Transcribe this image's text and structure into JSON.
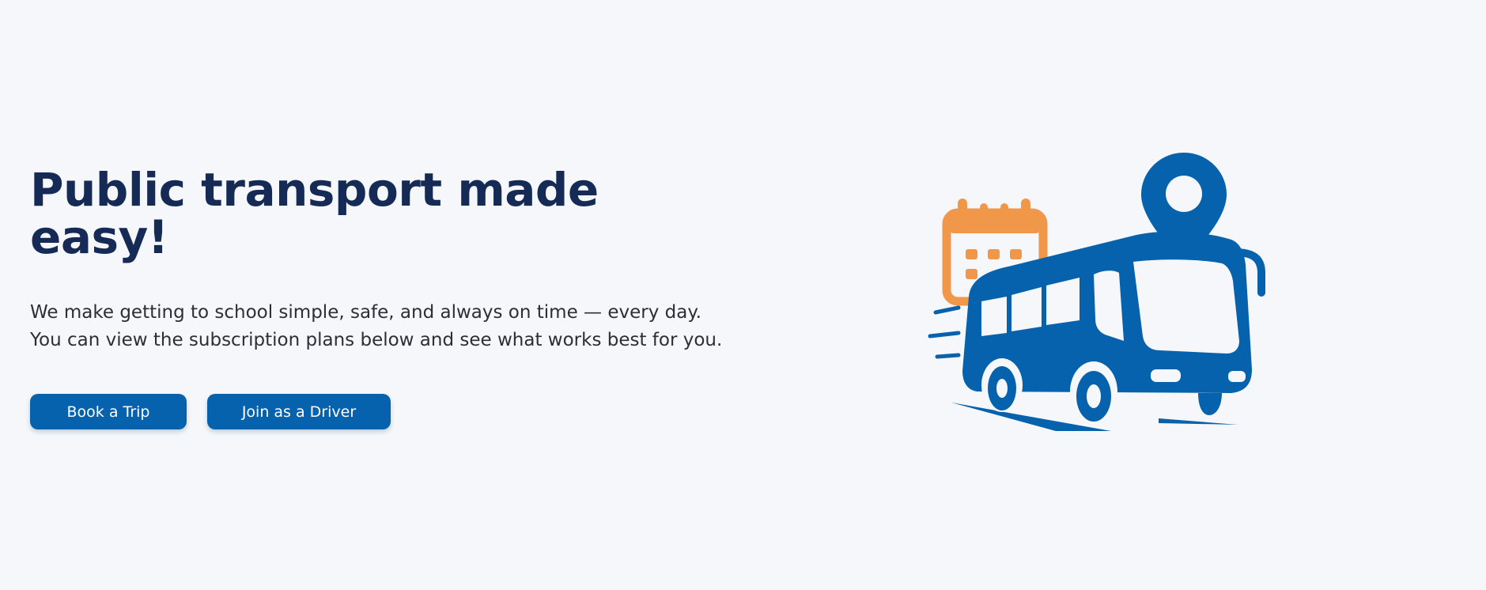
{
  "hero": {
    "title": "Public transport made easy!",
    "description": "We make getting to school simple, safe, and always on time — every day. You can view the subscription plans below and see what works best for you.",
    "buttons": {
      "book_trip": "Book a Trip",
      "join_driver": "Join as a Driver"
    }
  },
  "illustration": {
    "icons": [
      "calendar-icon",
      "location-pin-icon",
      "bus-icon"
    ],
    "colors": {
      "bus": "#0762ad",
      "calendar": "#f0974a"
    }
  },
  "theme": {
    "background": "#f5f7fa",
    "title_color": "#152a55",
    "text_color": "#2b2f36",
    "button_color": "#0762ad",
    "button_text_color": "#ffffff"
  }
}
